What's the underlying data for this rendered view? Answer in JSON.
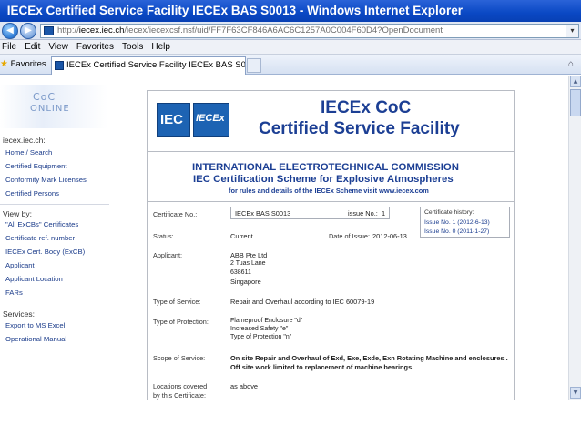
{
  "window": {
    "title": "IECEx Certified Service Facility IECEx BAS S0013 - Windows Internet Explorer"
  },
  "address": {
    "url_prefix": "http://",
    "url_domain": "iecex.iec.ch",
    "url_rest": "/iecex/iecexcsf.nsf/uid/FF7F63CF846A6AC6C1257A0C004F60D4?OpenDocument"
  },
  "menu": [
    "File",
    "Edit",
    "View",
    "Favorites",
    "Tools",
    "Help"
  ],
  "favorites_label": "Favorites",
  "tab_title": "IECEx Certified Service Facility IECEx BAS S0...",
  "sidebar": {
    "logo_line1": "CoC",
    "logo_line2": "ONLINE",
    "site_heading": "iecex.iec.ch:",
    "site_links": [
      "Home / Search",
      "Certified Equipment",
      "Conformity Mark Licenses",
      "Certified Persons"
    ],
    "view_heading": "View by:",
    "view_links": [
      "\"All ExCBs\" Certificates",
      "Certificate ref. number",
      "IECEx Cert. Body (ExCB)",
      "Applicant",
      "Applicant Location",
      "FARs"
    ],
    "services_heading": "Services:",
    "services_links": [
      "Export to MS Excel",
      "Operational Manual"
    ]
  },
  "certificate": {
    "heading_line1": "IECEx CoC",
    "heading_line2": "Certified Service Facility",
    "iec_logo": "IEC",
    "iecex_logo": "IECEx",
    "org_line1": "INTERNATIONAL ELECTROTECHNICAL COMMISSION",
    "org_line2": "IEC Certification Scheme for Explosive Atmospheres",
    "org_line3": "for rules and details of the IECEx Scheme visit www.iecex.com",
    "certificate_no_label": "Certificate No.:",
    "certificate_no": "IECEx BAS S0013",
    "issue_no_label": "issue No.:",
    "issue_no": "1",
    "history_label": "Certificate history:",
    "history": [
      "Issue No. 1 (2012-6-13)",
      "Issue No. 0 (2011-1-27)"
    ],
    "status_label": "Status:",
    "status": "Current",
    "date_label": "Date of Issue:",
    "date": "2012-06-13",
    "applicant_label": "Applicant:",
    "applicant_name": "ABB Pte Ltd",
    "applicant_address1": "2 Tuas Lane",
    "applicant_address2": "638611",
    "applicant_country": "Singapore",
    "type_service_label": "Type of Service:",
    "type_service": "Repair and Overhaul according to IEC 60079-19",
    "type_protection_label": "Type of Protection:",
    "protections": [
      "Flameproof Enclosure \"d\"",
      "Increased Safety \"e\"",
      "Type of Protection \"n\""
    ],
    "scope_label": "Scope of Service:",
    "scope_line1": "On site Repair and Overhaul of Exd, Exe, Exde, Exn Rotating Machine and enclosures .",
    "scope_line2": "Off site work limited to replacement of machine bearings.",
    "locations_label_line1": "Locations covered",
    "locations_label_line2": "by this Certificate:",
    "locations": "as above"
  }
}
